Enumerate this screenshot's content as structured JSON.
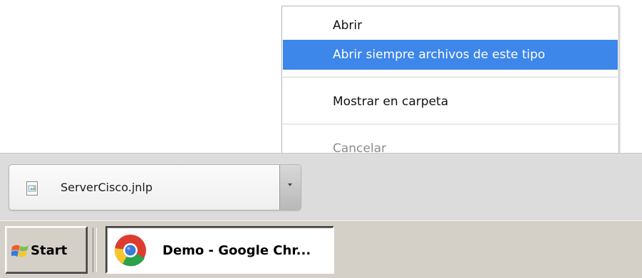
{
  "context_menu": {
    "items": [
      {
        "label": "Abrir",
        "state": "normal"
      },
      {
        "label": "Abrir siempre archivos de este tipo",
        "state": "highlighted"
      },
      {
        "label": "Mostrar en carpeta",
        "state": "normal"
      },
      {
        "label": "Cancelar",
        "state": "disabled"
      }
    ]
  },
  "download_shelf": {
    "file_name": "ServerCisco.jnlp",
    "file_icon": "jnlp-file-icon",
    "dropdown_icon": "chevron-down-icon"
  },
  "taskbar": {
    "start_label": "Start",
    "start_icon": "windows-flag-icon",
    "active_task": {
      "label": "Demo - Google Chr...",
      "icon": "chrome-icon"
    }
  },
  "colors": {
    "menu_highlight": "#3d86ea",
    "menu_highlight_text": "#ffffff",
    "disabled_text": "#8d8d8d",
    "shelf_background": "#dcdcdc",
    "taskbar_background": "#d4d0c8",
    "chrome_red": "#dc3d2f",
    "chrome_yellow": "#f7c62f",
    "chrome_green": "#2ca24b",
    "chrome_blue": "#3b7bd4"
  }
}
